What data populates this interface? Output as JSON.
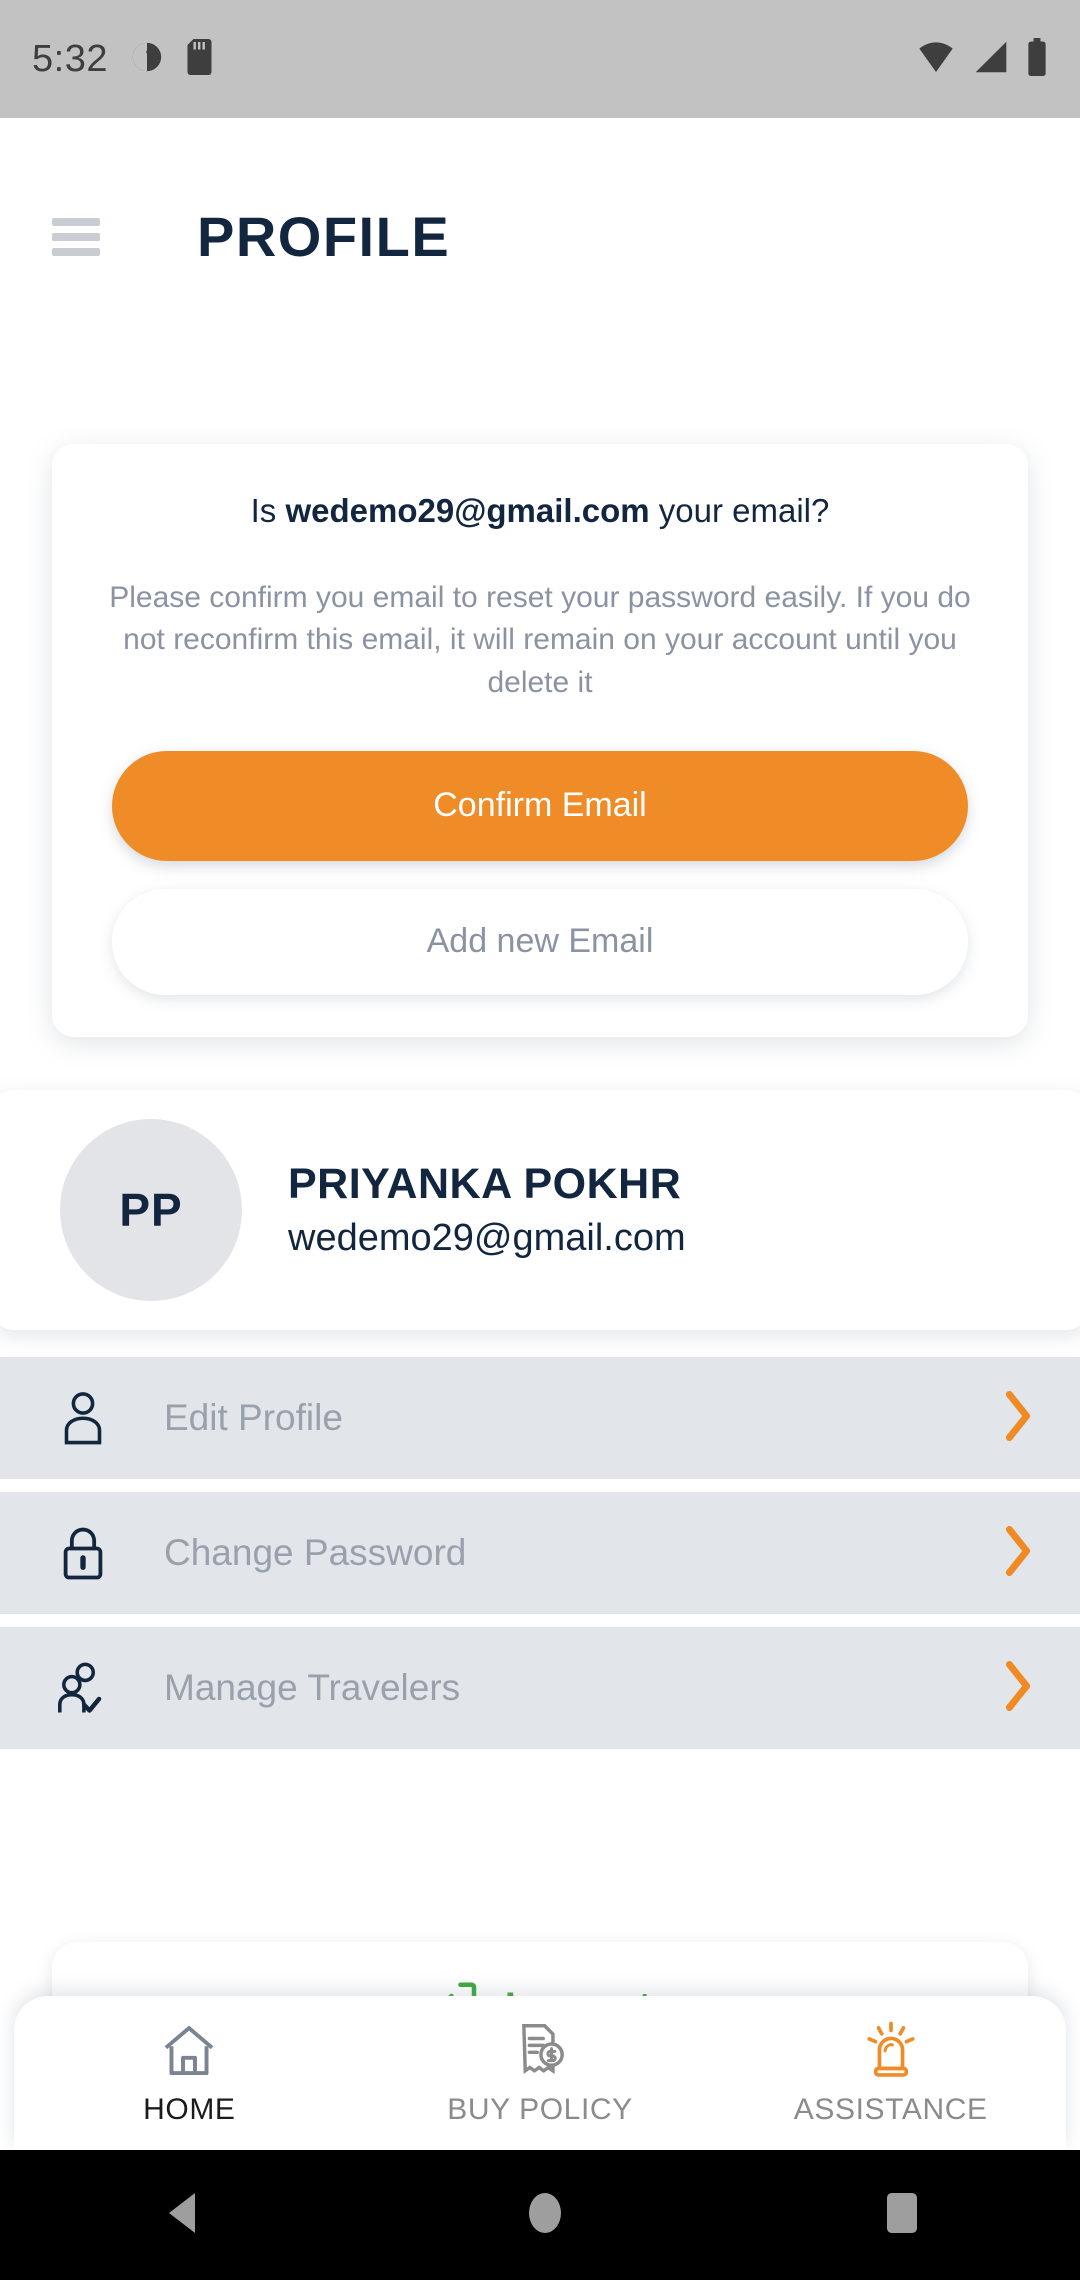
{
  "statusbar": {
    "time": "5:32",
    "left_icons": [
      "do-not-disturb-icon",
      "sd-card-icon"
    ],
    "right_icons": [
      "wifi-icon",
      "signal-icon",
      "battery-icon"
    ]
  },
  "header": {
    "menu_icon": "hamburger-menu-icon",
    "title": "PROFILE"
  },
  "email_card": {
    "question_prefix": "Is ",
    "question_email": "wedemo29@gmail.com",
    "question_suffix": " your email?",
    "description": "Please confirm you email to reset your password easily. If you do not reconfirm this email, it will remain on your account until you delete it",
    "confirm_label": "Confirm Email",
    "add_new_label": "Add new Email",
    "confirm_color": "#ef8c28"
  },
  "profile": {
    "initials": "PP",
    "name": "PRIYANKA POKHR",
    "email": "wedemo29@gmail.com",
    "avatar_bg": "#e2e4e8"
  },
  "menu": {
    "items": [
      {
        "label": "Edit Profile",
        "icon": "user-icon",
        "chevron": "chevron-right-icon"
      },
      {
        "label": "Change Password",
        "icon": "lock-icon",
        "chevron": "chevron-right-icon"
      },
      {
        "label": "Manage Travelers",
        "icon": "manage-travelers-icon",
        "chevron": "chevron-right-icon"
      }
    ],
    "row_bg": "#e2e5e9",
    "chevron_color": "#f08a22"
  },
  "logout": {
    "label": "Log out",
    "icon": "logout-icon",
    "color": "#3caa3c"
  },
  "bottomnav": {
    "items": [
      {
        "label": "HOME",
        "icon": "home-icon",
        "active": true
      },
      {
        "label": "BUY POLICY",
        "icon": "policy-invoice-icon",
        "active": false
      },
      {
        "label": "ASSISTANCE",
        "icon": "siren-icon",
        "active": false
      }
    ]
  },
  "androidnav": {
    "back": "back-triangle-icon",
    "home": "home-circle-icon",
    "recents": "recents-square-icon"
  }
}
